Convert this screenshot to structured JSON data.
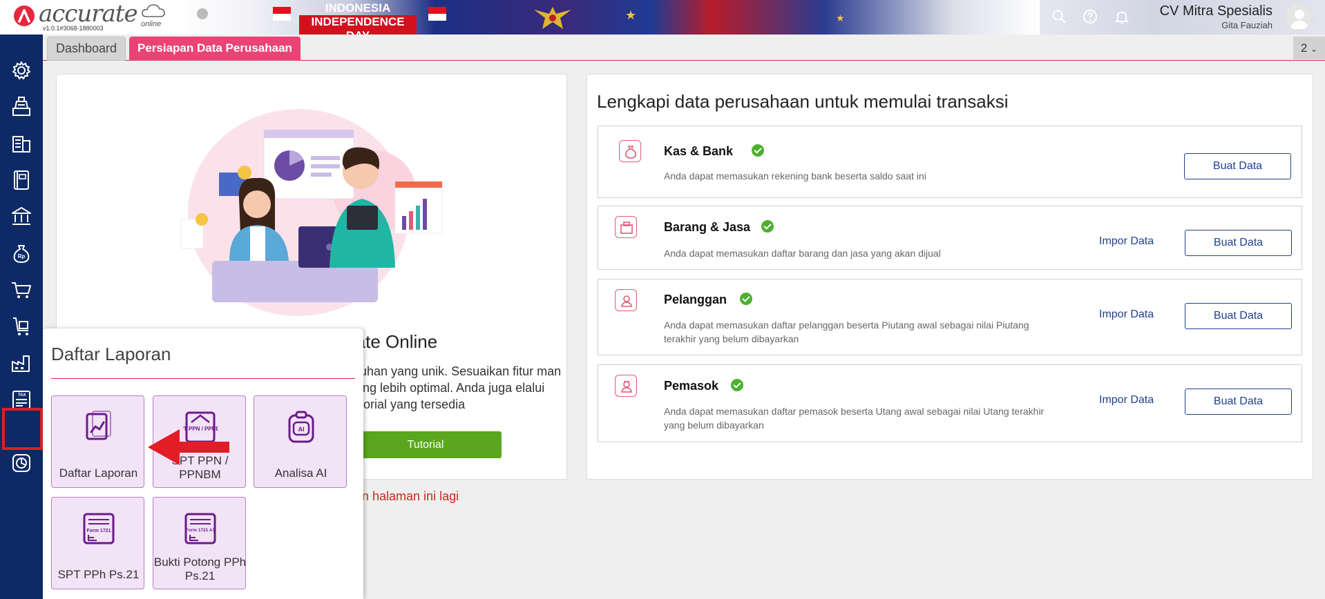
{
  "app": {
    "logo_text": "accurate",
    "logo_sub": "online",
    "version": "v1.0.1#3068-1880003"
  },
  "banner": {
    "line1": "INDONESIA",
    "line2": "INDEPENDENCE DAY"
  },
  "header": {
    "company": "CV Mitra Spesialis",
    "user": "Gita Fauziah"
  },
  "tabs": {
    "items": [
      {
        "label": "Dashboard"
      },
      {
        "label": "Persiapan Data Perusahaan"
      }
    ],
    "count": "2"
  },
  "sidebar": {
    "items": [
      "gear-icon",
      "cashier-icon",
      "building-icon",
      "book-icon",
      "bank-icon",
      "money-bag-icon",
      "cart-icon",
      "delivery-icon",
      "factory-icon",
      "tax-icon",
      "report-icon"
    ],
    "active": "report-icon"
  },
  "welcome": {
    "title_tail": "rate Online",
    "desc": "utuhan yang unik. Sesuaikan fitur man yang lebih optimal. Anda juga elalui tutorial yang tersedia",
    "tutorial_label": "Tutorial",
    "hide_link": "n halaman ini lagi"
  },
  "setup": {
    "title": "Lengkapi data perusahaan untuk memulai transaksi",
    "impor_label": "Impor Data",
    "buat_label": "Buat Data",
    "items": [
      {
        "title": "Kas & Bank",
        "desc": "Anda dapat memasukan rekening bank beserta saldo saat ini",
        "done": true
      },
      {
        "title": "Barang & Jasa",
        "desc": "Anda dapat memasukan daftar barang dan jasa yang akan dijual",
        "done": true
      },
      {
        "title": "Pelanggan",
        "desc": "Anda dapat memasukan daftar pelanggan beserta Piutang awal sebagai nilai Piutang terakhir yang belum dibayarkan",
        "done": true
      },
      {
        "title": "Pemasok",
        "desc": "Anda dapat memasukan daftar pemasok beserta Utang awal sebagai nilai Utang terakhir yang belum dibayarkan",
        "done": true
      }
    ]
  },
  "popup": {
    "title": "Daftar Laporan",
    "tiles": [
      {
        "label": "Daftar Laporan",
        "icon": "report-chart-icon"
      },
      {
        "label": "SPT PPN / PPNBM",
        "icon": "spt-ppn-icon",
        "icon_text": "SPT PPN / PPNBM"
      },
      {
        "label": "Analisa AI",
        "icon": "ai-clipboard-icon",
        "icon_text": "AI"
      },
      {
        "label": "SPT PPh Ps.21",
        "icon": "form-1721-icon",
        "icon_text": "Form 1721"
      },
      {
        "label": "Bukti Potong PPh Ps.21",
        "icon": "form-1721-a1-icon",
        "icon_text": "Form 1721 A1"
      }
    ]
  },
  "colors": {
    "sidebar": "#0e2a66",
    "accent": "#e94475",
    "primary_blue": "#1e3f8c",
    "success": "#4cb030",
    "tutorial_green": "#5aa61e",
    "tile_bg": "#f2e3f7",
    "tile_icon": "#6a1b8a"
  }
}
